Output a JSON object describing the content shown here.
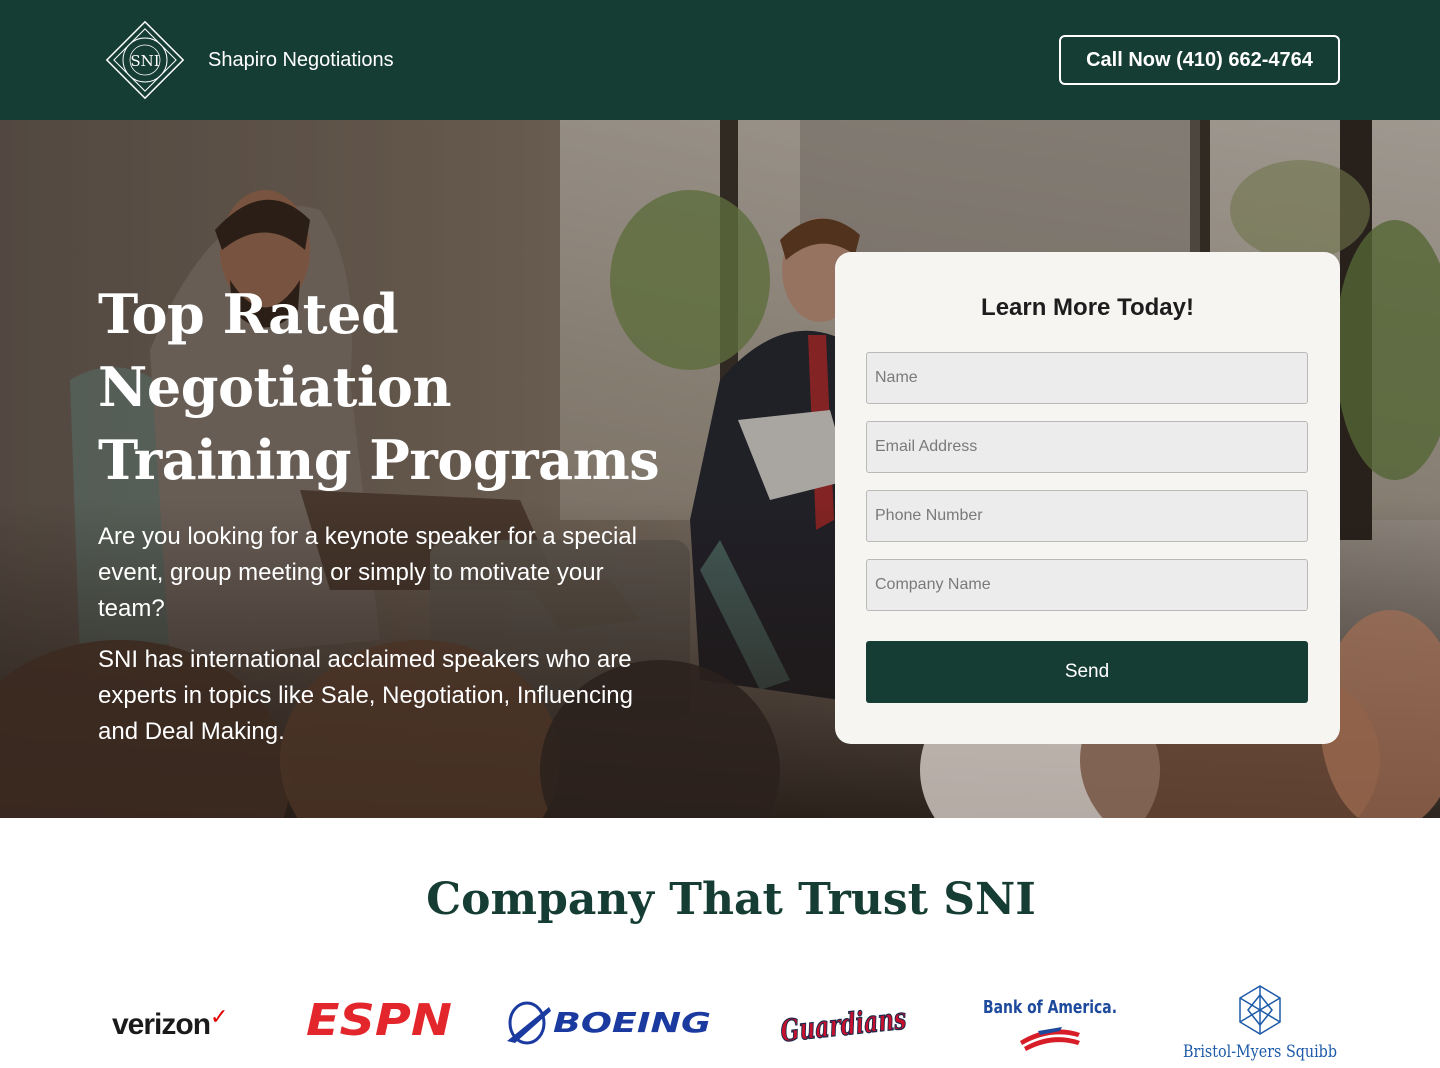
{
  "header": {
    "logo_monogram": "SNI",
    "logo_ring_text": "SPEAKERS · TRAINING · CONSULTING · LEARNING",
    "brand_name": "Shapiro Negotiations",
    "call_label": "Call Now (410) 662-4764"
  },
  "hero": {
    "title": "Top Rated Negotiation Training Programs",
    "paragraph1": "Are you looking for a keynote speaker for a special event, group meeting or simply to motivate your team?",
    "paragraph2": "SNI has international acclaimed speakers who are experts in topics like Sale, Negotiation, Influencing and Deal Making."
  },
  "form": {
    "title": "Learn More Today!",
    "fields": [
      {
        "placeholder": "Name",
        "value": ""
      },
      {
        "placeholder": "Email Address",
        "value": ""
      },
      {
        "placeholder": "Phone Number",
        "value": ""
      },
      {
        "placeholder": "Company Name",
        "value": ""
      }
    ],
    "submit_label": "Send"
  },
  "trust": {
    "title": "Company That Trust SNI",
    "logos": [
      "verizon",
      "ESPN",
      "BOEING",
      "Guardians",
      "Bank of America.",
      "Bristol-Myers Squibb"
    ]
  },
  "colors": {
    "brand_green": "#163d33",
    "form_bg": "#f6f5f2",
    "verizon_red": "#e00000",
    "espn_red": "#e3262c",
    "boeing_blue": "#1a3aa0",
    "guardians_red": "#c8102e",
    "boa_blue": "#1d4a9c",
    "bms_blue": "#1d5aa8"
  }
}
